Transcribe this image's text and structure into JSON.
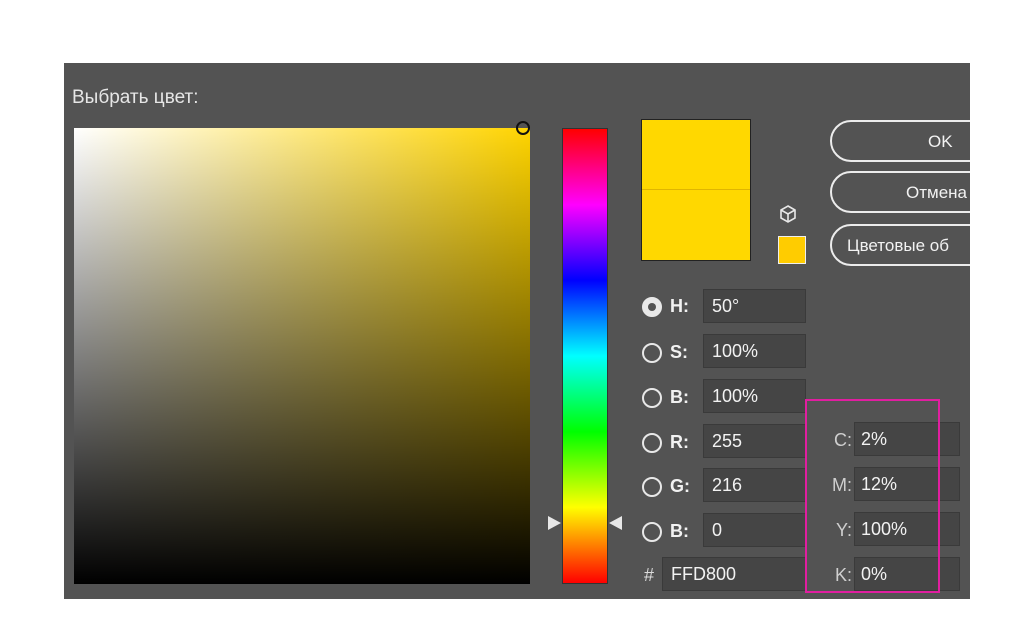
{
  "dialog": {
    "title": "Выбрать цвет:"
  },
  "buttons": {
    "ok": "OK",
    "cancel": "Отмена",
    "swatches": "Цветовые об"
  },
  "colors": {
    "current": "#ffd800",
    "previous": "#ffd800",
    "web_safe": "#ffcc00",
    "highlight": "#e11ea0"
  },
  "hsb": {
    "h": {
      "label": "H:",
      "value": "50°",
      "selected": true
    },
    "s": {
      "label": "S:",
      "value": "100%"
    },
    "b": {
      "label": "B:",
      "value": "100%"
    }
  },
  "rgb": {
    "r": {
      "label": "R:",
      "value": "255"
    },
    "g": {
      "label": "G:",
      "value": "216"
    },
    "b": {
      "label": "B:",
      "value": "0"
    }
  },
  "hex": {
    "label": "#",
    "value": "FFD800"
  },
  "cmyk": {
    "c": {
      "label": "C:",
      "value": "2%"
    },
    "m": {
      "label": "M:",
      "value": "12%"
    },
    "y": {
      "label": "Y:",
      "value": "100%"
    },
    "k": {
      "label": "K:",
      "value": "0%"
    }
  },
  "icons": {
    "gamut_warning": "cube-icon",
    "hue_slider": "triangle-arrows"
  }
}
